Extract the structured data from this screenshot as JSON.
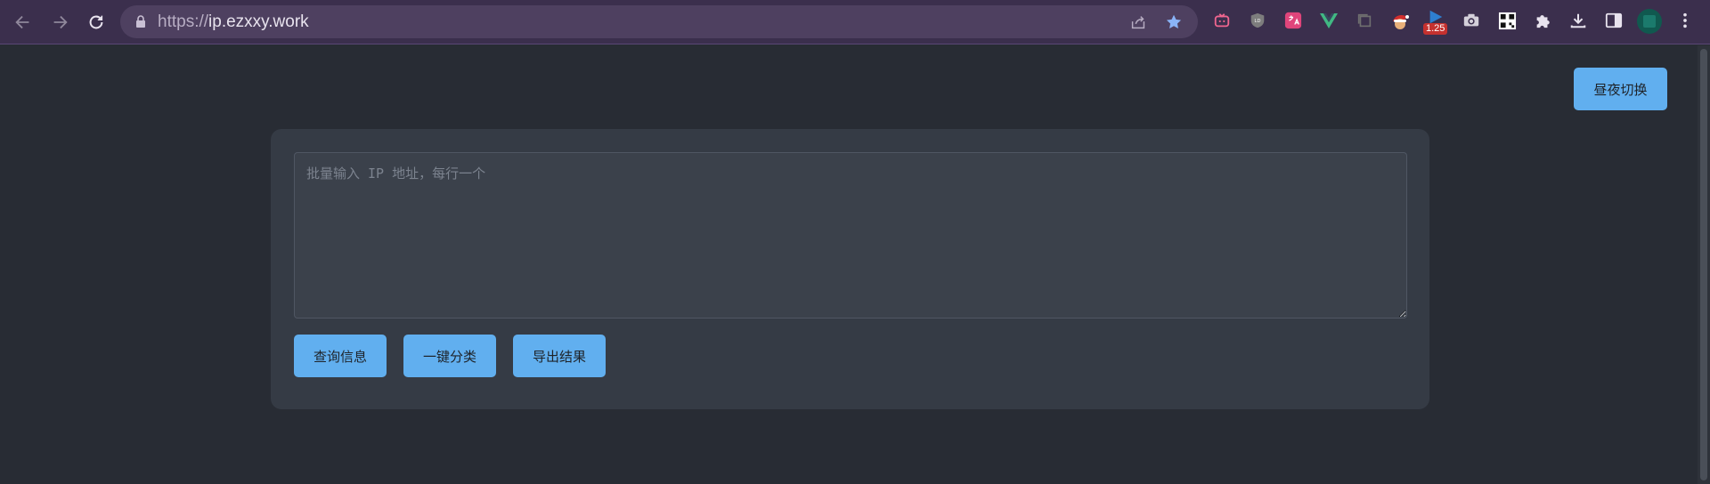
{
  "browser": {
    "url_scheme": "https://",
    "url_host": "ip.ezxxy.work",
    "extension_badge": "1.25",
    "colors": {
      "frame": "#3b2f4d",
      "omnibox": "#4e4060",
      "bookmark_star": "#8ab4f8"
    }
  },
  "page": {
    "theme_toggle_label": "昼夜切换",
    "ip_input_placeholder": "批量输入 IP 地址，每行一个",
    "actions": {
      "query": "查询信息",
      "classify": "一键分类",
      "export": "导出结果"
    },
    "colors": {
      "background": "#282c34",
      "card": "#353b45",
      "button": "#61afef"
    }
  }
}
